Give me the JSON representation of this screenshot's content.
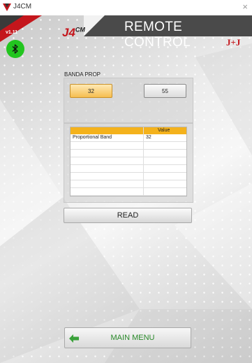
{
  "window": {
    "title": "J4CM",
    "close_glyph": "×"
  },
  "header": {
    "title": "REMOTE CONTROL",
    "version": "v1.11",
    "logo_text": "J4",
    "logo_sup": "CM",
    "brand_text": "J+J"
  },
  "bluetooth": {
    "icon": "bluetooth-icon",
    "status_color": "#22c51f"
  },
  "banda": {
    "label": "BANDA PROP",
    "options": [
      {
        "label": "32",
        "selected": true
      },
      {
        "label": "55",
        "selected": false
      }
    ]
  },
  "table": {
    "columns": [
      "",
      "Value"
    ],
    "rows": [
      {
        "name": "Proportional Band",
        "value": "32"
      }
    ]
  },
  "read_button": "READ",
  "main_menu_button": "MAIN MENU",
  "colors": {
    "accent_red": "#c4161c",
    "header_dark": "#4a4a4a",
    "table_header": "#f4b21c",
    "menu_green": "#2a8a2a"
  }
}
